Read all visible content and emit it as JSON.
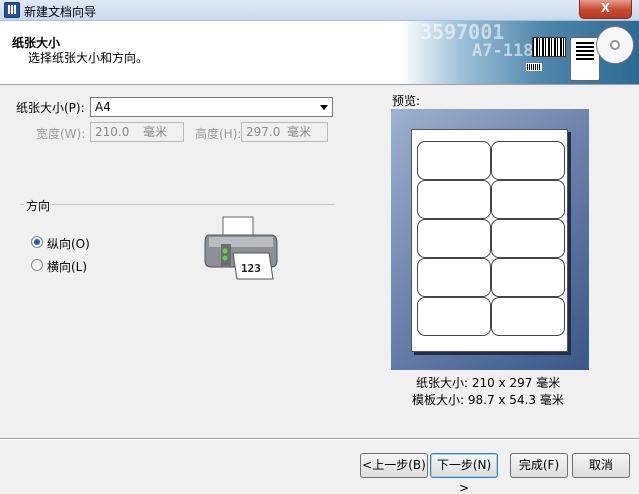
{
  "window": {
    "title": "新建文档向导",
    "close_label": "X"
  },
  "header": {
    "title": "纸张大小",
    "subtitle": "选择纸张大小和方向。",
    "banner_number_1": "3597001",
    "banner_number_2": "A7-118"
  },
  "paper": {
    "size_label": "纸张大小(P):",
    "size_value": "A4",
    "width_label": "宽度(W):",
    "width_value": "210.0",
    "width_unit": "毫米",
    "height_label": "高度(H):",
    "height_value": "297.0",
    "height_unit": "毫米"
  },
  "orientation": {
    "title": "方向",
    "portrait_label": "纵向(O)",
    "landscape_label": "横向(L)",
    "selected": "portrait",
    "printer_label": "123"
  },
  "preview": {
    "title": "预览:",
    "paper_size_text": "纸张大小: 210 x 297 毫米",
    "template_size_text": "模板大小: 98.7 x 54.3 毫米",
    "columns": 2,
    "rows": 5
  },
  "buttons": {
    "back": "<上一步(B)",
    "next": "下一步(N) >",
    "finish": "完成(F)",
    "cancel": "取消"
  },
  "colors": {
    "accent": "#1b5fb0",
    "preview_background": "#6e84ad",
    "close_button": "#c8472f"
  }
}
